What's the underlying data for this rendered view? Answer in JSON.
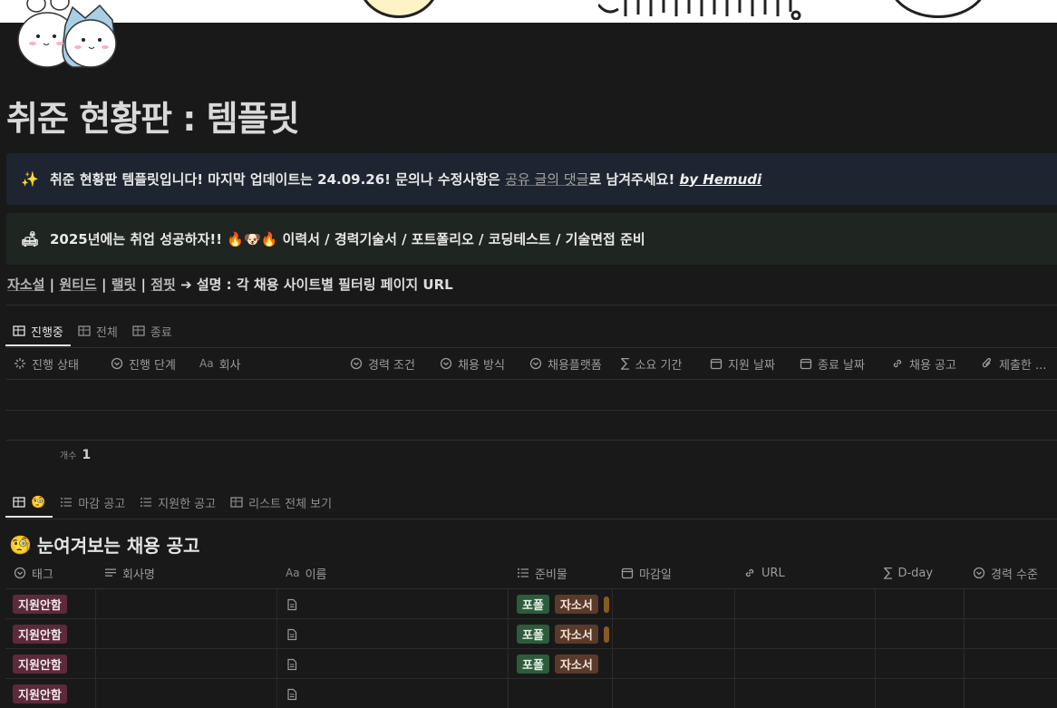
{
  "page": {
    "title": "취준 현황판 : 템플릿"
  },
  "callouts": [
    {
      "emoji": "✨",
      "text": "취준 현황판 템플릿입니다! 마지막 업데이트는 24.09.26! 문의나 수정사항은 ",
      "link": "공유 글의 댓글",
      "text2": "로 남겨주세요! ",
      "signature": "by Hemudi"
    },
    {
      "emoji": "🛋",
      "text": "2025년에는 취업 성공하자!! 🔥🐶🔥 이력서 / 경력기술서 / 포트폴리오 / 코딩테스트 / 기술면접 준비"
    }
  ],
  "sites": {
    "items": [
      "자소설",
      "원티드",
      "랠릿",
      "점핏"
    ],
    "separator": " | ",
    "arrow_text": " ➔ 설명 : 각 채용 사이트별 필터링 페이지 URL"
  },
  "db1": {
    "tabs": [
      {
        "label": "진행중",
        "active": true
      },
      {
        "label": "전체",
        "active": false
      },
      {
        "label": "종료",
        "active": false
      }
    ],
    "columns": [
      "진행 상태",
      "진행 단계",
      "회사",
      "경력 조건",
      "채용 방식",
      "채용플랫폼",
      "소요 기간",
      "지원 날짜",
      "종료 날짜",
      "채용 공고",
      "제출한 ..."
    ],
    "count_label": "개수",
    "count_value": "1"
  },
  "db2": {
    "tabs": [
      {
        "label": "🧐",
        "active": true
      },
      {
        "label": "마감 공고",
        "active": false
      },
      {
        "label": "지원한 공고",
        "active": false
      },
      {
        "label": "리스트 전체 보기",
        "active": false
      }
    ],
    "view_title": "눈여겨보는 채용 공고",
    "view_emoji": "🧐",
    "columns": [
      "태그",
      "회사명",
      "이름",
      "준비물",
      "마감일",
      "URL",
      "D-day",
      "경력 수준"
    ],
    "rows": [
      {
        "tag": "지원안함",
        "prep": [
          "포폴",
          "자소서"
        ],
        "more": true
      },
      {
        "tag": "지원안함",
        "prep": [
          "포폴",
          "자소서"
        ],
        "more": true
      },
      {
        "tag": "지원안함",
        "prep": [
          "포폴",
          "자소서"
        ],
        "more": false
      },
      {
        "tag": "지원안함",
        "prep": [],
        "more": false
      }
    ]
  },
  "colors": {
    "background": "#191919",
    "tag_red": "#5c2a3b",
    "tag_green": "#2c5c3c",
    "tag_brown": "#5a3a2a"
  }
}
